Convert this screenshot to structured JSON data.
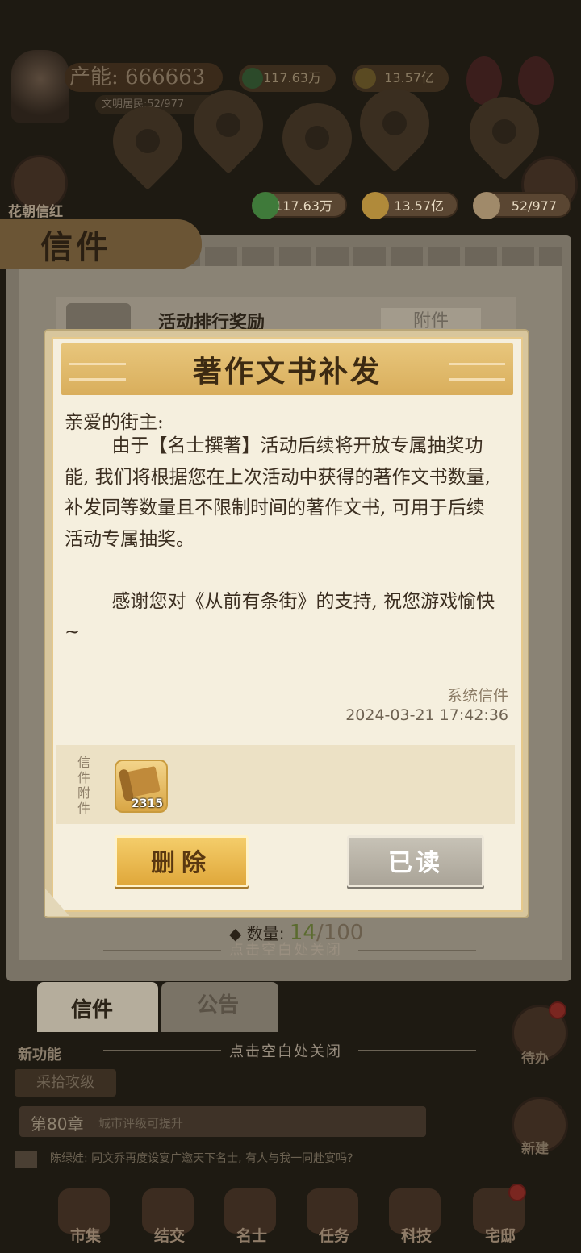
{
  "hud": {
    "production": "产能: 666663",
    "residents": "文明居民:52/977",
    "res_green": "117.63万",
    "res_gold": "13.57亿",
    "flower_label": "花朝信红"
  },
  "resources_bar": {
    "green": "117.63万",
    "gold": "13.57亿",
    "people": "52/977"
  },
  "mail_window": {
    "title": "信件",
    "item_title": "活动排行奖励",
    "attach_tag": "附件",
    "count_label": "数量:",
    "count_current": "14",
    "count_max": "/100",
    "tabs": [
      "信件",
      "公告"
    ],
    "close_hint": "点击空白处关闭"
  },
  "background": {
    "new_func": "新功能",
    "gather_tag": "采拾攻级",
    "chapter": "第80章",
    "chapter_text": "城市评级可提升",
    "chat": "陈绿娃: 同文乔再度设宴广邀天下名士, 有人与我一同赴宴吗?",
    "side_right": [
      "待办",
      "新建"
    ],
    "close_hint": "点击空白处关闭"
  },
  "bottom_nav": [
    {
      "label": "市集"
    },
    {
      "label": "结交"
    },
    {
      "label": "名士"
    },
    {
      "label": "任务"
    },
    {
      "label": "科技"
    },
    {
      "label": "宅邸"
    }
  ],
  "dialog": {
    "title": "著作文书补发",
    "salutation": "亲爱的街主:",
    "body": "        由于【名士撰著】活动后续将开放专属抽奖功能, 我们将根据您在上次活动中获得的著作文书数量, 补发同等数量且不限制时间的著作文书, 可用于后续活动专属抽奖。\n\n        感谢您对《从前有条街》的支持, 祝您游戏愉快~",
    "sender": "系统信件",
    "date": "2024-03-21  17:42:36",
    "attachment_label": "信件附件",
    "attachment_item": {
      "icon": "scroll-icon",
      "count": "2315"
    },
    "delete_button": "删除",
    "read_button": "已读"
  },
  "colors": {
    "header_gold": "#d9ae5c",
    "delete_btn": "#e0a83b",
    "read_btn": "#aaa498",
    "paper": "#f5efde"
  }
}
